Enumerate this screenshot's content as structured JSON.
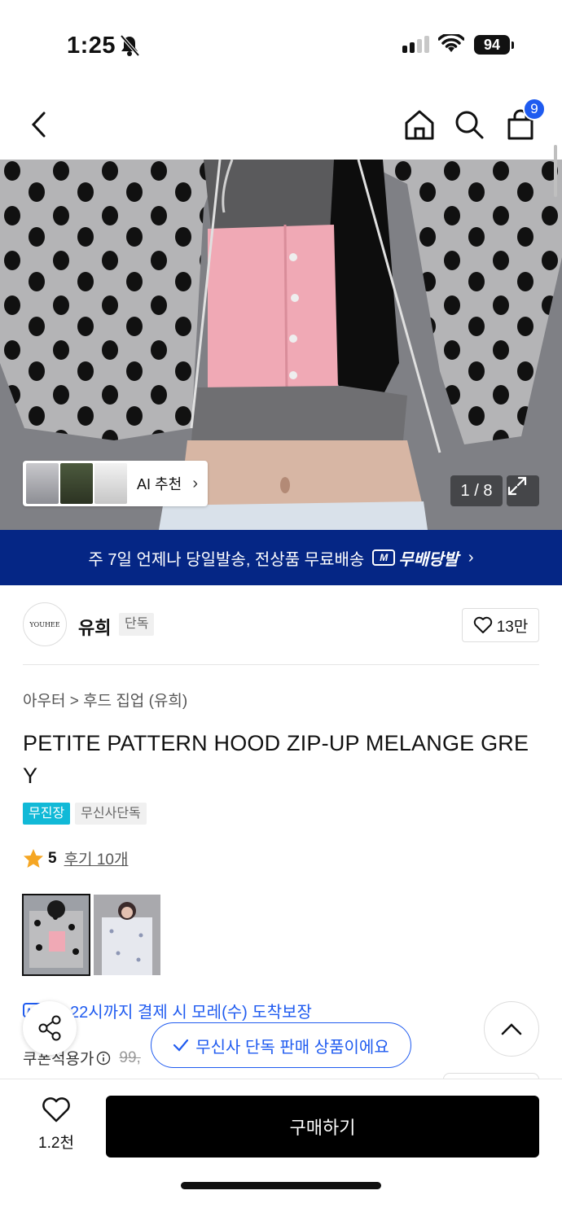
{
  "status_bar": {
    "time": "1:25",
    "battery": "94"
  },
  "header": {
    "cart_count": "9"
  },
  "gallery": {
    "counter": "1 / 8",
    "ai_label": "AI 추천",
    "ai_arrow": "›"
  },
  "banner": {
    "text": "주 7일 언제나 당일발송, 전상품 무료배송",
    "badge": "무배당발",
    "badge_icon": "M",
    "chevron": "›"
  },
  "brand": {
    "logo_text": "YOUHEE",
    "name": "유희",
    "tag": "단독",
    "likes": "13만"
  },
  "product": {
    "breadcrumb": "아우터 > 후드 집업 (유희)",
    "title": "PETITE PATTERN HOOD ZIP-UP MELANGE GREY",
    "tags": [
      "무진장",
      "무신사단독"
    ],
    "rating": "5",
    "reviews": "후기 10개",
    "delivery": "늘 22시까지 결제 시 모레(수) 도착보장",
    "price_label": "쿠폰적용가",
    "price_original": "99,"
  },
  "toast": {
    "text": "무신사 단독 판매 상품이에요"
  },
  "bottom_bar": {
    "wish_count": "1.2천",
    "buy_label": "구매하기"
  },
  "colors": {
    "accent": "#1f5bf0",
    "banner": "#052685",
    "tag_primary": "#11b9d7",
    "star": "#f5a623"
  }
}
